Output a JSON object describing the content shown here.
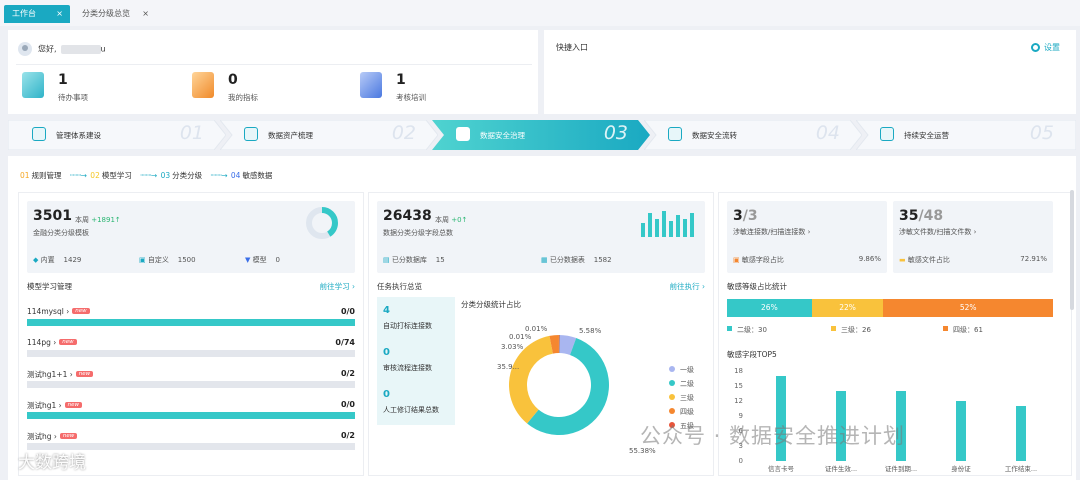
{
  "tabs": [
    {
      "label": "工作台",
      "close": "×"
    },
    {
      "label": "分类分级总览",
      "close": "×"
    }
  ],
  "welcome": {
    "greeting": "您好,",
    "name_suffix": "u",
    "stats": [
      {
        "value": "1",
        "label": "待办事项"
      },
      {
        "value": "0",
        "label": "我的指标"
      },
      {
        "value": "1",
        "label": "考核培训"
      }
    ]
  },
  "quick": {
    "title": "快捷入口",
    "settings": "设置"
  },
  "steps": [
    {
      "label": "管理体系建设",
      "num": "01"
    },
    {
      "label": "数据资产梳理",
      "num": "02"
    },
    {
      "label": "数据安全治理",
      "num": "03"
    },
    {
      "label": "数据安全流转",
      "num": "04"
    },
    {
      "label": "持续安全运营",
      "num": "05"
    }
  ],
  "crumbs": [
    {
      "num": "01",
      "label": "规则管理"
    },
    {
      "num": "02",
      "label": "模型学习"
    },
    {
      "num": "03",
      "label": "分类分级"
    },
    {
      "num": "04",
      "label": "敏感数据"
    }
  ],
  "panel1": {
    "value": "3501",
    "week_label": "本周",
    "week_delta": "+1891↑",
    "title": "金融分类分级模板",
    "donut_fraction": 0.41,
    "sub": [
      {
        "label": "内置",
        "value": "1429"
      },
      {
        "label": "自定义",
        "value": "1500"
      },
      {
        "label": "模型",
        "value": "0"
      }
    ],
    "section": "模型学习管理",
    "link": "前往学习 ›",
    "items": [
      {
        "name": "114mysql ›",
        "tag": "new",
        "value": "0/0",
        "fill": 1.0
      },
      {
        "name": "114pg ›",
        "tag": "new",
        "value": "0/74",
        "fill": 0
      },
      {
        "name": "测试hg1+1 ›",
        "tag": "new",
        "value": "0/2",
        "fill": 0
      },
      {
        "name": "测试hg1 ›",
        "tag": "new",
        "value": "0/0",
        "fill": 1.0
      },
      {
        "name": "测试hg ›",
        "tag": "new",
        "value": "0/2",
        "fill": 0
      }
    ]
  },
  "panel2": {
    "value": "26438",
    "week_label": "本周",
    "week_delta": "+0↑",
    "title": "数据分类分级字段总数",
    "sub": [
      {
        "label": "已分数据库",
        "value": "15"
      },
      {
        "label": "已分数据表",
        "value": "1582"
      }
    ],
    "section": "任务执行总览",
    "link": "前往执行 ›",
    "tasks": [
      {
        "value": "4",
        "label": "自动打标连接数"
      },
      {
        "value": "0",
        "label": "审核流程连接数"
      },
      {
        "value": "0",
        "label": "人工修订结果总数"
      }
    ],
    "pie_title": "分类分级统计占比"
  },
  "chart_data": {
    "type": "pie",
    "title": "分类分级统计占比",
    "series": [
      {
        "name": "一级",
        "value": 5.58,
        "label": "5.58%",
        "color": "#a9b6f0"
      },
      {
        "name": "二级",
        "value": 55.38,
        "label": "55.38%",
        "color": "#35c8c8"
      },
      {
        "name": "三级",
        "value": 35.9,
        "label": "35.9...",
        "color": "#f9c23c"
      },
      {
        "name": "四级",
        "value": 3.03,
        "label": "3.03%",
        "color": "#f5872f"
      },
      {
        "name": "五级",
        "value": 0.01,
        "label": "0.01%",
        "color": "#e8543a"
      },
      {
        "name": "",
        "value": 0.01,
        "label": "0.01%",
        "color": "#999999"
      }
    ],
    "legend_position": "right"
  },
  "panel3": {
    "conn_value": "3",
    "conn_total": "/3",
    "conn_label": "涉敏连接数/扫描连接数 ›",
    "file_value": "35",
    "file_total": "/48",
    "file_label": "涉敏文件数/扫描文件数 ›",
    "field_ratio_label": "敏感字段占比",
    "field_ratio": "9.86%",
    "file_ratio_label": "敏感文件占比",
    "file_ratio": "72.91%",
    "sev_title": "敏感等级占比统计",
    "sev": [
      {
        "label": "26%",
        "legend": "二级：30",
        "pct": 26,
        "color": "#35c8c8"
      },
      {
        "label": "22%",
        "legend": "三级：26",
        "pct": 22,
        "color": "#f9c23c"
      },
      {
        "label": "52%",
        "legend": "四级：61",
        "pct": 52,
        "color": "#f5872f"
      }
    ],
    "top_title": "敏感字段TOP5",
    "top": {
      "yticks": [
        "18",
        "15",
        "12",
        "9",
        "6",
        "3",
        "0"
      ],
      "categories": [
        "信言卡号",
        "证件生效...",
        "证件到期...",
        "身份证",
        "工作结束..."
      ],
      "values": [
        17,
        14,
        14,
        12,
        11
      ],
      "ymax": 18
    }
  },
  "watermark": {
    "text1": "公众号 · 数据安全推进计划",
    "text2": "大数跨境"
  }
}
